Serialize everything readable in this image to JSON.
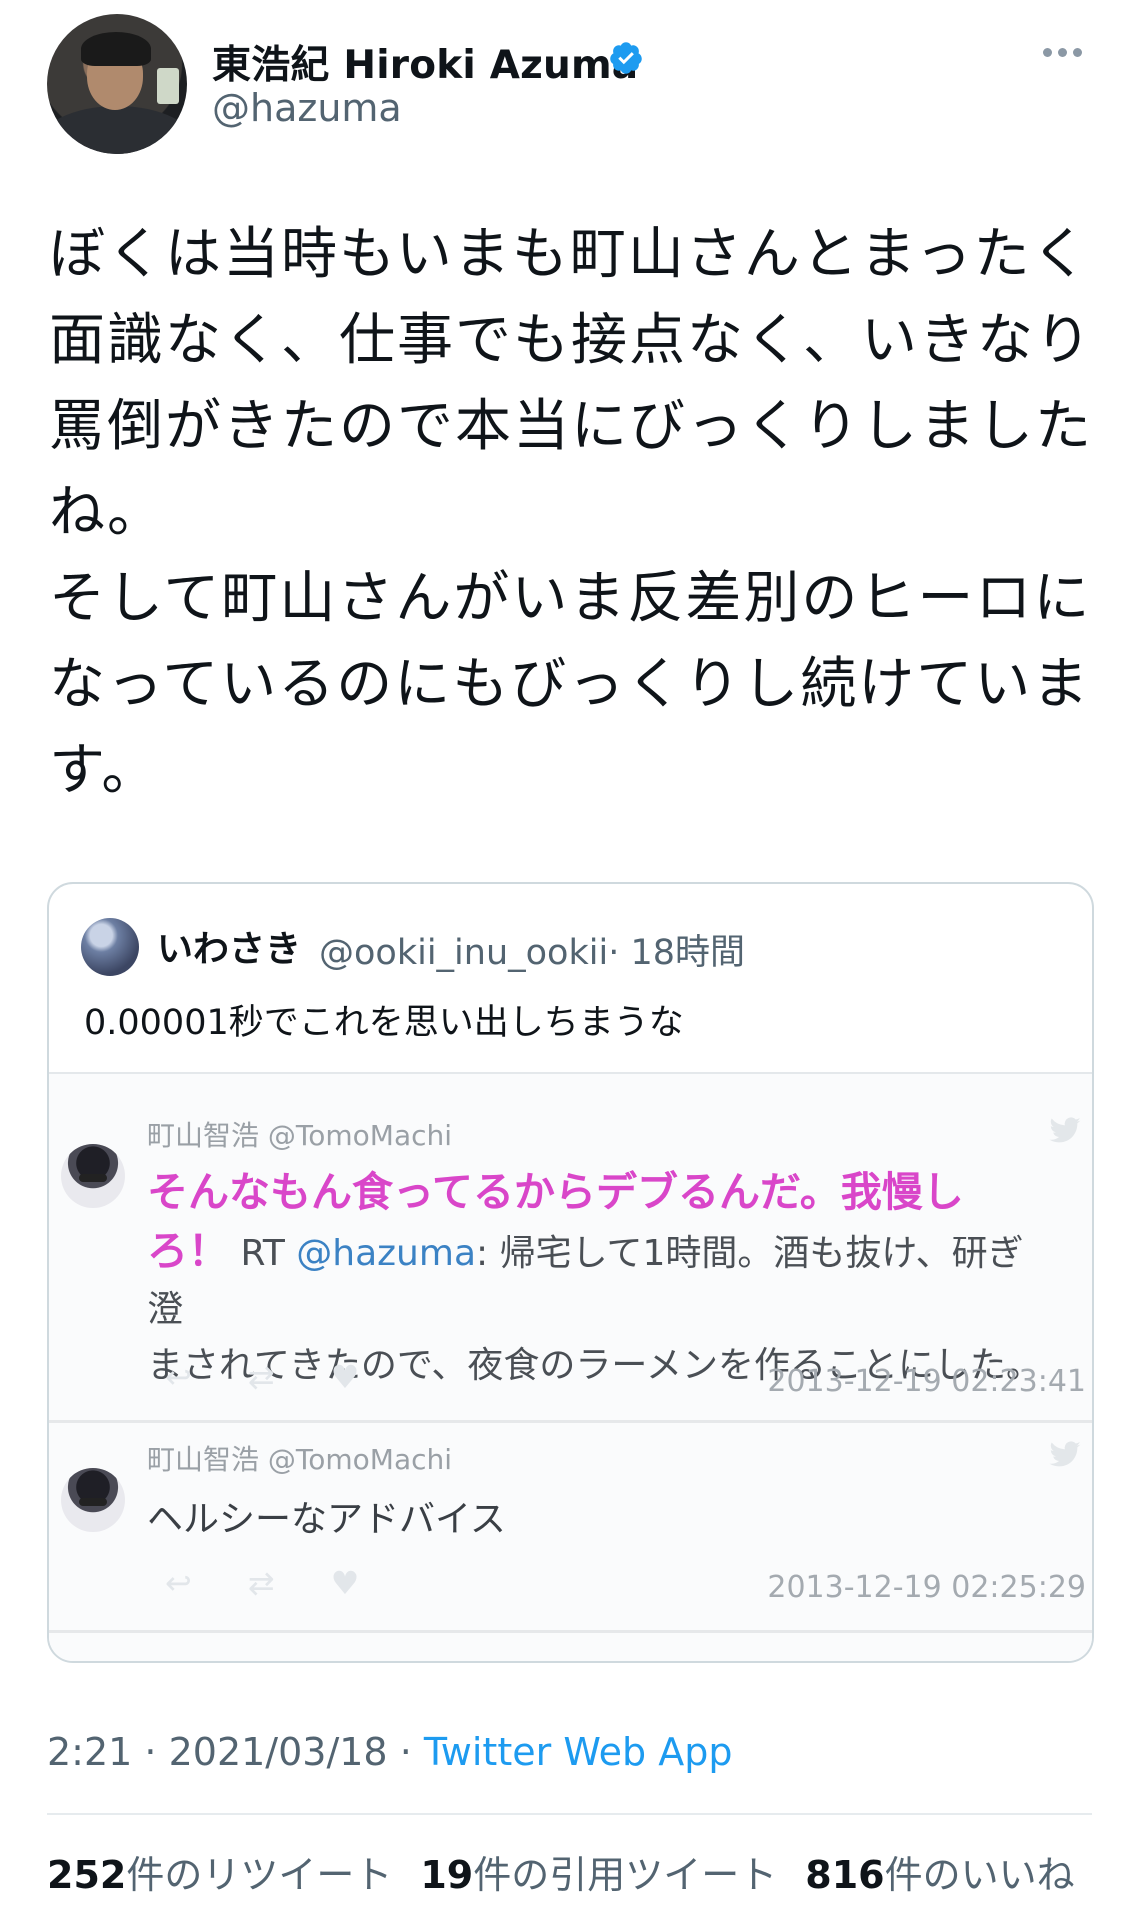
{
  "tweet": {
    "author_name": "東浩紀 Hiroki Azuma",
    "handle": "@hazuma",
    "text": "ぼくは当時もいまも町山さんとまったく\n面識なく、仕事でも接点なく、いきなり\n罵倒がきたので本当にびっくりしました\nね。\nそして町山さんがいま反差別のヒーロに\nなっているのにもびっくりし続けていま\nす。",
    "time": "2:21",
    "date": "2021/03/18",
    "app": "Twitter Web App",
    "separator": " · ",
    "stats": {
      "retweets_count": "252",
      "retweets_label": "件のリツイート",
      "quotes_count": "19",
      "quotes_label": "件の引用ツイート",
      "likes_count": "816",
      "likes_label": "件のいいね"
    }
  },
  "quote": {
    "name": "いわさき",
    "handle": "@ookii_inu_ookii",
    "age": "· 18時間",
    "text": "0.00001秒でこれを思い出しちまうな",
    "entries": [
      {
        "author": "町山智浩 @TomoMachi",
        "highlight": "そんなもん食ってるからデブるんだ。我慢し\nろ！",
        "rt": " RT ",
        "mention": "@hazuma",
        "rest": ": 帰宅して1時間。酒も抜け、研ぎ澄\nまされてきたので、夜食のラーメンを作ることにした。",
        "timestamp": "2013-12-19 02:23:41"
      },
      {
        "author": "町山智浩 @TomoMachi",
        "body": "ヘルシーなアドバイス",
        "timestamp": "2013-12-19 02:25:29"
      }
    ]
  },
  "icons": {
    "verified": "verified-badge-icon",
    "more": "more-options-icon",
    "bird": "twitter-bird-icon",
    "reply": "reply-icon",
    "retweet": "retweet-icon",
    "like": "heart-icon"
  },
  "colors": {
    "accent": "#1d9bf0",
    "highlight": "#d946c9",
    "muted": "#536471"
  }
}
